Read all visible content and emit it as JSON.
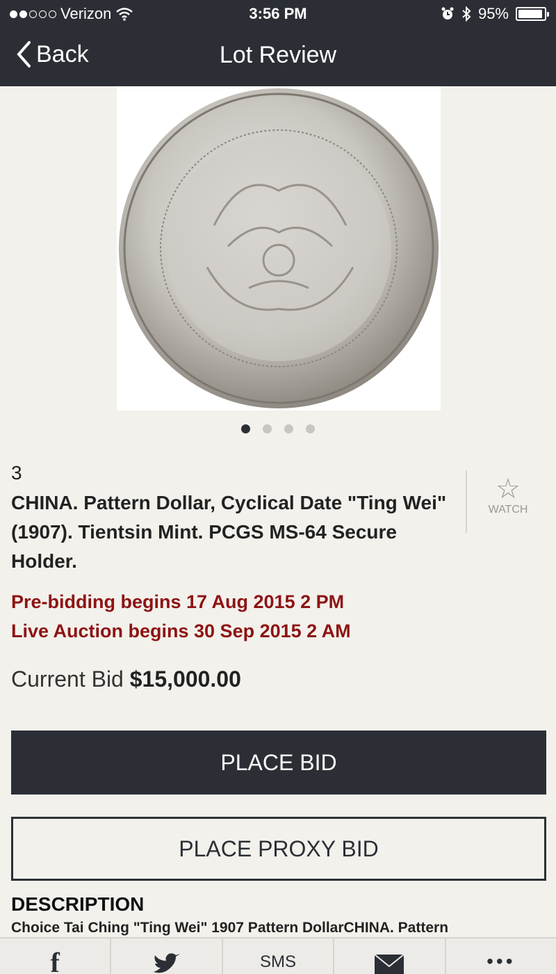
{
  "status_bar": {
    "carrier": "Verizon",
    "time": "3:56 PM",
    "battery": "95%",
    "battery_level": 0.95
  },
  "nav": {
    "back_label": "Back",
    "title": "Lot Review"
  },
  "gallery": {
    "page_count": 4,
    "active_index": 0
  },
  "lot": {
    "number": "3",
    "title": "CHINA. Pattern Dollar, Cyclical Date \"Ting Wei\" (1907). Tientsin Mint. PCGS MS-64 Secure Holder.",
    "watch_label": "WATCH",
    "prebidding": "Pre-bidding begins 17 Aug 2015 2 PM",
    "live_auction": "Live Auction begins 30 Sep 2015 2 AM",
    "current_bid_label": "Current Bid",
    "current_bid_amount": "$15,000.00"
  },
  "actions": {
    "place_bid": "PLACE BID",
    "place_proxy_bid": "PLACE PROXY BID"
  },
  "description": {
    "heading": "DESCRIPTION",
    "text": "Choice Tai Ching \"Ting Wei\" 1907 Pattern DollarCHINA. Pattern"
  },
  "share_bar": {
    "facebook": "f",
    "sms": "SMS",
    "more": "•••"
  },
  "colors": {
    "header_bg": "#2b2f35",
    "page_bg": "#f3f1ec",
    "date_red": "#8d1414"
  }
}
